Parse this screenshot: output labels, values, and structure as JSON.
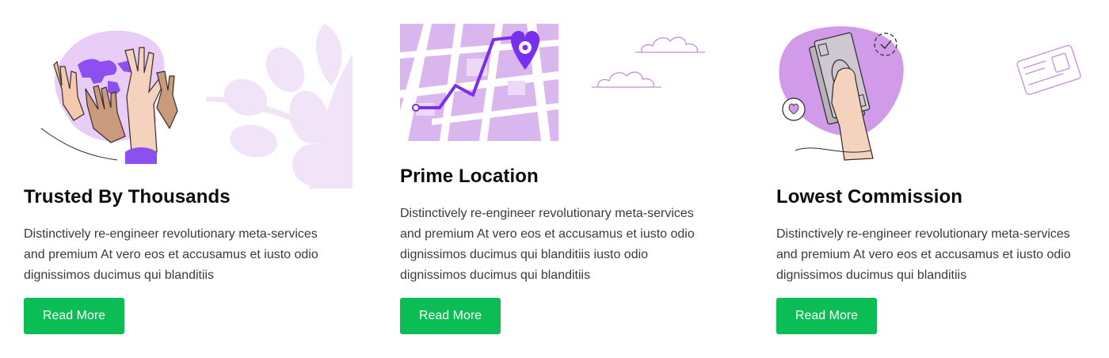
{
  "cards": [
    {
      "title": "Trusted By Thousands",
      "description": "Distinctively re-engineer revolutionary meta-services and premium  At vero eos et accusamus et iusto odio dignissimos ducimus qui blanditiis",
      "button_label": "Read More",
      "illustration_icon": "raised-hands-globe-icon"
    },
    {
      "title": "Prime Location",
      "description": "Distinctively re-engineer revolutionary meta-services and premium  At vero eos et accusamus et iusto odio dignissimos ducimus qui blanditiis iusto odio dignissimos ducimus qui blanditiis",
      "button_label": "Read More",
      "illustration_icon": "map-pin-route-icon"
    },
    {
      "title": "Lowest Commission",
      "description": "Distinctively re-engineer revolutionary meta-services and premium  At vero eos et accusamus et iusto odio dignissimos ducimus qui blanditiis",
      "button_label": "Read More",
      "illustration_icon": "hand-cash-icon"
    }
  ],
  "colors": {
    "accent_green": "#0cbc55",
    "illustration_purple": "#7a2ff0",
    "light_lavender": "#ecdcf6",
    "medium_lavender": "#d5a6ea"
  }
}
